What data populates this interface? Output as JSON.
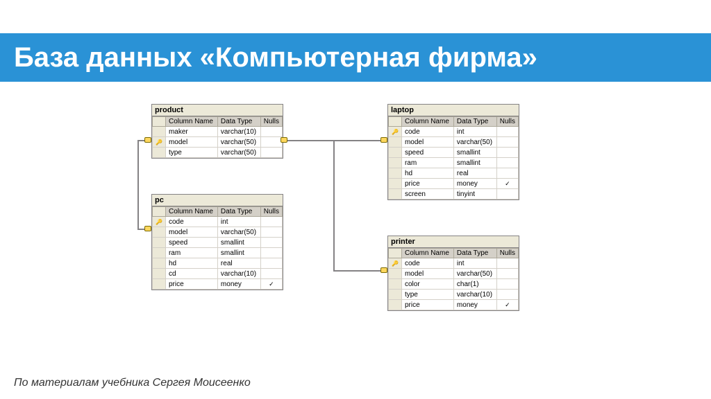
{
  "title": "База данных «Компьютерная фирма»",
  "footer": "По материалам учебника Сергея Моисеенко",
  "headers": {
    "col_name": "Column Name",
    "data_type": "Data Type",
    "nulls": "Nulls"
  },
  "tables": {
    "product": {
      "title": "product",
      "cols": [
        {
          "key": false,
          "name": "maker",
          "type": "varchar(10)",
          "nulls": false
        },
        {
          "key": true,
          "name": "model",
          "type": "varchar(50)",
          "nulls": false
        },
        {
          "key": false,
          "name": "type",
          "type": "varchar(50)",
          "nulls": false
        }
      ]
    },
    "laptop": {
      "title": "laptop",
      "cols": [
        {
          "key": true,
          "name": "code",
          "type": "int",
          "nulls": false
        },
        {
          "key": false,
          "name": "model",
          "type": "varchar(50)",
          "nulls": false
        },
        {
          "key": false,
          "name": "speed",
          "type": "smallint",
          "nulls": false
        },
        {
          "key": false,
          "name": "ram",
          "type": "smallint",
          "nulls": false
        },
        {
          "key": false,
          "name": "hd",
          "type": "real",
          "nulls": false
        },
        {
          "key": false,
          "name": "price",
          "type": "money",
          "nulls": true
        },
        {
          "key": false,
          "name": "screen",
          "type": "tinyint",
          "nulls": false
        }
      ]
    },
    "pc": {
      "title": "pc",
      "cols": [
        {
          "key": true,
          "name": "code",
          "type": "int",
          "nulls": false
        },
        {
          "key": false,
          "name": "model",
          "type": "varchar(50)",
          "nulls": false
        },
        {
          "key": false,
          "name": "speed",
          "type": "smallint",
          "nulls": false
        },
        {
          "key": false,
          "name": "ram",
          "type": "smallint",
          "nulls": false
        },
        {
          "key": false,
          "name": "hd",
          "type": "real",
          "nulls": false
        },
        {
          "key": false,
          "name": "cd",
          "type": "varchar(10)",
          "nulls": false
        },
        {
          "key": false,
          "name": "price",
          "type": "money",
          "nulls": true
        }
      ]
    },
    "printer": {
      "title": "printer",
      "cols": [
        {
          "key": true,
          "name": "code",
          "type": "int",
          "nulls": false
        },
        {
          "key": false,
          "name": "model",
          "type": "varchar(50)",
          "nulls": false
        },
        {
          "key": false,
          "name": "color",
          "type": "char(1)",
          "nulls": false
        },
        {
          "key": false,
          "name": "type",
          "type": "varchar(10)",
          "nulls": false
        },
        {
          "key": false,
          "name": "price",
          "type": "money",
          "nulls": true
        }
      ]
    }
  }
}
